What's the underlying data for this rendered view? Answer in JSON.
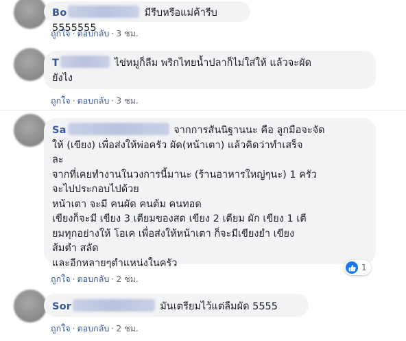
{
  "actions": {
    "like": "ถูกใจ",
    "reply": "ตอบกลับ",
    "separator": "·"
  },
  "comments": [
    {
      "author_visible": "Bo",
      "text": "มีรีบหรือแม่ค้ารีบ 5555555",
      "time": "3 ชม."
    },
    {
      "author_visible": "T",
      "text_line1": "ไข่หมูก็ลืม พริกไทยน้ำปลาก็ไม่ใส่ให้ แล้วจะผัด",
      "text_line2": "ยังไง",
      "time": "3 ชม."
    },
    {
      "author_visible": "Sa",
      "text_first": "จากการสันนิฐานนะ คือ ลูกมือจะจัด",
      "lines": [
        "ให้ (เขียง) เพื่อส่งให้พ่อครัว ผัด(หน้าเตา) แล้วคิดว่าทำเสร็จ",
        "ละ",
        "จากที่เคยทำงานในวงการนี้มานะ (ร้านอาหารใหญ่ๆนะ) 1 ครัว",
        "จะไปประกอบไปด้วย",
        "หน้าเตา จะมี คนผัด คนต้ม คนทอด",
        "เขียงก็จะมี เขียง 3 เตียมของสด เขียง 2 เตียม ผัก เขียง 1 เตี",
        "ยมทุกอย่างให้ โอเค เพื่อส่งให้หน้าเตา ก็จะมีเขียงยำ เขียง",
        "ส้มตำ สลัด",
        "และอีกหลายๆตำแหน่งในครัว"
      ],
      "reaction_count": "1",
      "reaction_icon": "like-thumb-icon",
      "time": "2 ชม."
    },
    {
      "author_visible": "Sor",
      "text": "มันเตรียมไว้แต่ลืมผัด 5555",
      "time": "2 ชม."
    }
  ],
  "colors": {
    "author": "#385898",
    "link": "#385898",
    "bubble": "#f2f3f5",
    "meta": "#606770",
    "like_blue": "#1877f2"
  }
}
